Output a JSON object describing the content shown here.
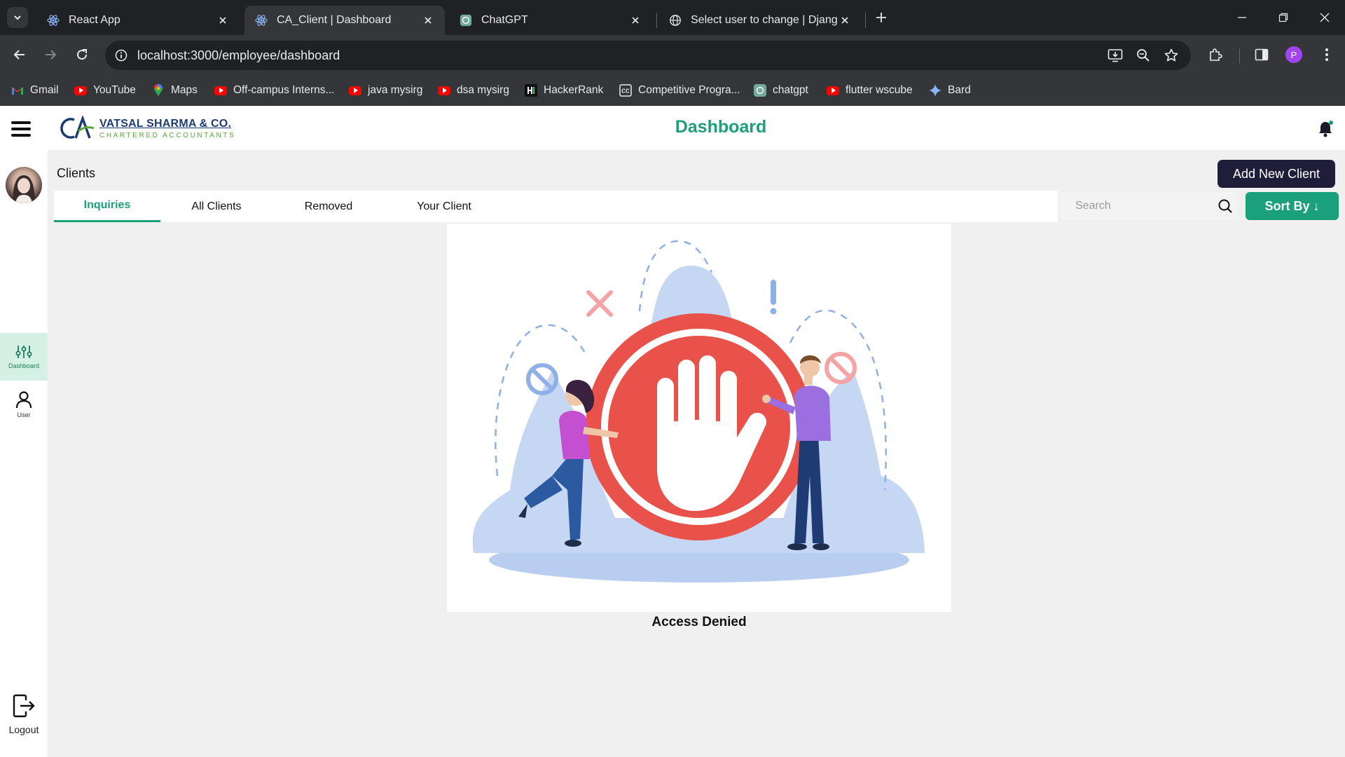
{
  "browser": {
    "tabs": [
      {
        "title": "React App",
        "active": false,
        "favicon": "react-icon"
      },
      {
        "title": "CA_Client | Dashboard",
        "active": true,
        "favicon": "react-icon"
      },
      {
        "title": "ChatGPT",
        "active": false,
        "favicon": "chatgpt-icon"
      },
      {
        "title": "Select user to change | Django s",
        "active": false,
        "favicon": "globe-icon"
      }
    ],
    "url": "localhost:3000/employee/dashboard",
    "profile_initial": "P",
    "bookmarks": [
      {
        "label": "Gmail",
        "icon": "gmail-icon"
      },
      {
        "label": "YouTube",
        "icon": "youtube-icon"
      },
      {
        "label": "Maps",
        "icon": "maps-icon"
      },
      {
        "label": "Off-campus Interns...",
        "icon": "youtube-icon"
      },
      {
        "label": "java mysirg",
        "icon": "youtube-icon"
      },
      {
        "label": "dsa mysirg",
        "icon": "youtube-icon"
      },
      {
        "label": "HackerRank",
        "icon": "hackerrank-icon"
      },
      {
        "label": "Competitive Progra...",
        "icon": "codechef-icon"
      },
      {
        "label": "chatgpt",
        "icon": "chatgpt-icon"
      },
      {
        "label": "flutter wscube",
        "icon": "youtube-icon"
      },
      {
        "label": "Bard",
        "icon": "bard-icon"
      }
    ]
  },
  "app": {
    "logo": {
      "mark": "CA",
      "name": "VATSAL SHARMA & CO.",
      "subtitle": "CHARTERED ACCOUNTANTS"
    },
    "page_title": "Dashboard",
    "sidebar": {
      "items": [
        {
          "label": "Dashboard",
          "icon": "sliders-icon",
          "active": true
        },
        {
          "label": "User",
          "icon": "user-icon",
          "active": false
        }
      ],
      "logout_label": "Logout"
    },
    "section_title": "Clients",
    "add_button": "Add New Client",
    "tabs": [
      {
        "label": "Inquiries",
        "active": true
      },
      {
        "label": "All Clients",
        "active": false
      },
      {
        "label": "Removed",
        "active": false
      },
      {
        "label": "Your Client",
        "active": false
      }
    ],
    "search": {
      "placeholder": "Search",
      "value": ""
    },
    "sort_button": "Sort By ↓",
    "message": "Access Denied"
  },
  "colors": {
    "accent": "#1aa07a",
    "dark_button": "#1f1d3a",
    "stop_red": "#e8524a",
    "illustration_blue": "#b9cdf0"
  }
}
